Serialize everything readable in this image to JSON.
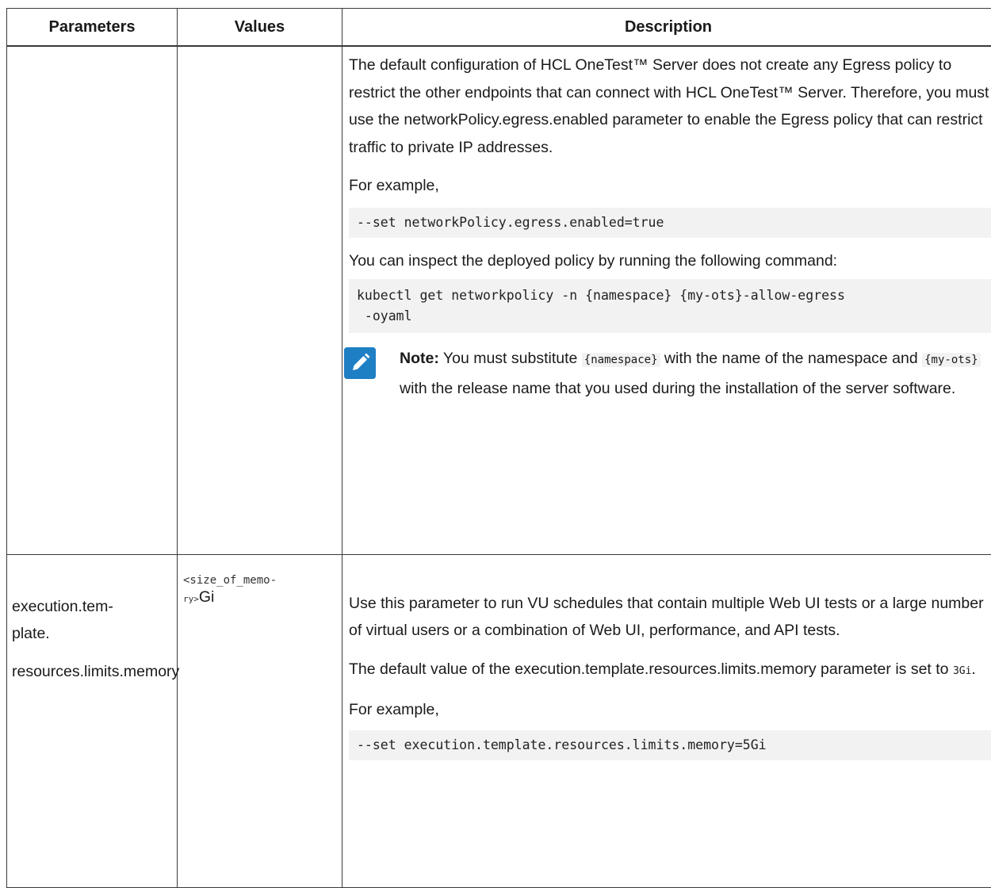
{
  "table": {
    "headers": [
      "Parameters",
      "Values",
      "Description"
    ],
    "row1": {
      "paragraph1": "The default configuration of HCL OneTest™ Server does not create any Egress policy to restrict the other endpoints that can connect with HCL OneTest™ Server. Therefore, you must use the networkPolicy.egress.enabled parameter to enable the Egress policy that can restrict traffic to private IP addresses.",
      "for_example": "For example,",
      "code1": "--set networkPolicy.egress.enabled=true",
      "inspect_text": "You can inspect the deployed policy by running the following command:",
      "code2_line1": "kubectl get networkpolicy -n {namespace} {my-ots}-allow-egress",
      "code2_line2": " -oyaml",
      "note_label": "Note:",
      "note_text_a": " You must substitute ",
      "note_code_a": "{namespace}",
      "note_text_b": " with the name of the name­space and ",
      "note_code_b": "{my-ots}",
      "note_text_c": " with the release name that you used during the installation of the server software.",
      "note_icon": "pencil-note-icon"
    },
    "row2": {
      "param_line1": "execution.tem­plate.",
      "param_line2": "resources.limits­.memory",
      "value_mono_a": "<size_of_memo-",
      "value_mono_b": "ry>",
      "value_suffix": "Gi",
      "paragraph1": "Use this parameter to run VU schedules that contain multiple Web UI tests or a large number of virtual users or a combination of Web UI, performance, and API tests.",
      "paragraph2_a": "The default value of the execution.template.resources.limits.memory para­meter is set to ",
      "paragraph2_code": "3Gi",
      "paragraph2_b": ".",
      "for_example": "For example,",
      "code1": "--set execution.template.resources.limits.memory=5Gi"
    }
  }
}
